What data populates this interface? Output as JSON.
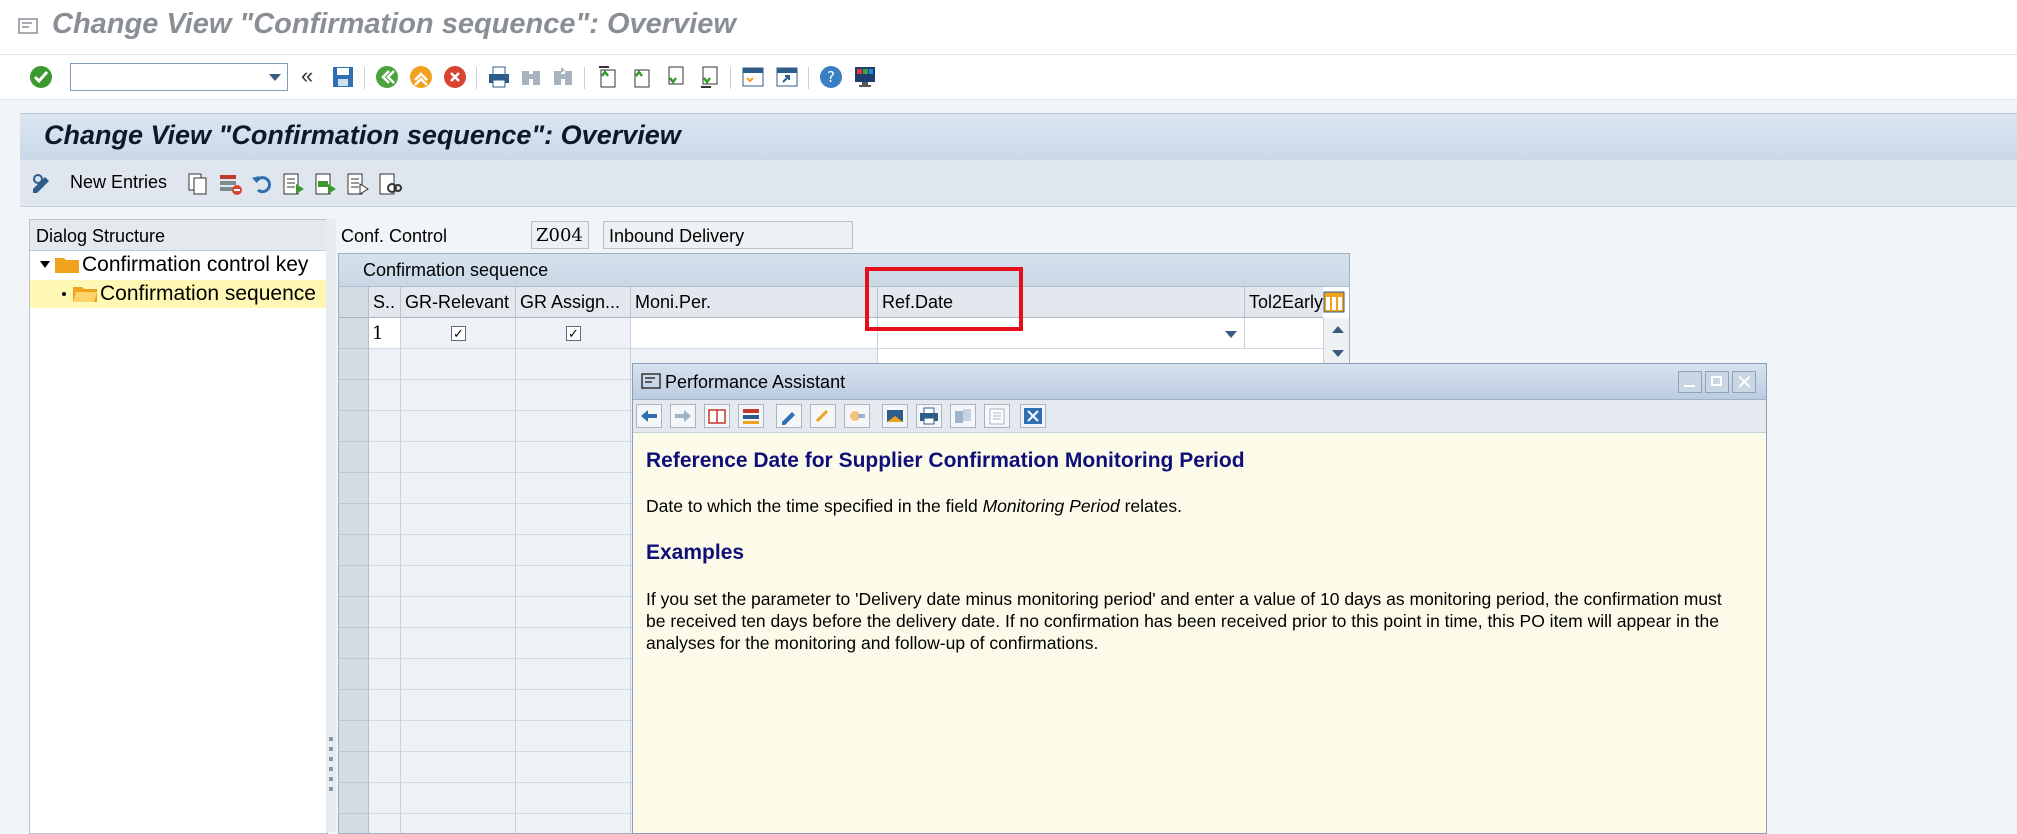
{
  "window": {
    "title": "Change View \"Confirmation sequence\": Overview"
  },
  "app": {
    "title": "Change View \"Confirmation sequence\": Overview",
    "new_entries": "New Entries"
  },
  "dialog_structure": {
    "header": "Dialog Structure",
    "items": [
      {
        "label": "Confirmation control key",
        "expanded": true
      },
      {
        "label": "Confirmation sequence",
        "selected": true
      }
    ]
  },
  "conf_control": {
    "label": "Conf. Control",
    "code": "Z004",
    "description": "Inbound Delivery"
  },
  "grid": {
    "title": "Confirmation sequence",
    "columns": [
      "S..",
      "GR-Relevant",
      "GR Assign...",
      "Moni.Per.",
      "Ref.Date",
      "Tol2Early"
    ],
    "rows": [
      {
        "seq": "1",
        "gr_relevant": true,
        "gr_assign": true,
        "moni_per": "",
        "ref_date": ""
      }
    ]
  },
  "performance_assistant": {
    "title": "Performance Assistant",
    "heading": "Reference Date for Supplier Confirmation Monitoring Period",
    "desc_prefix": "Date to which the time specified in the field ",
    "desc_italic": "Monitoring Period",
    "desc_suffix": " relates.",
    "examples_heading": "Examples",
    "example_text": "If you set the parameter to 'Delivery date minus monitoring period' and enter a value of 10 days as monitoring period, the confirmation must be received ten days before the delivery date. If no confirmation has been received prior to this point in time, this PO item will appear in the analyses for the monitoring and follow-up of confirmations."
  },
  "colors": {
    "highlight": "#e3101a",
    "selected_row": "#fff8b5",
    "pa_heading": "#0f0f7a"
  }
}
